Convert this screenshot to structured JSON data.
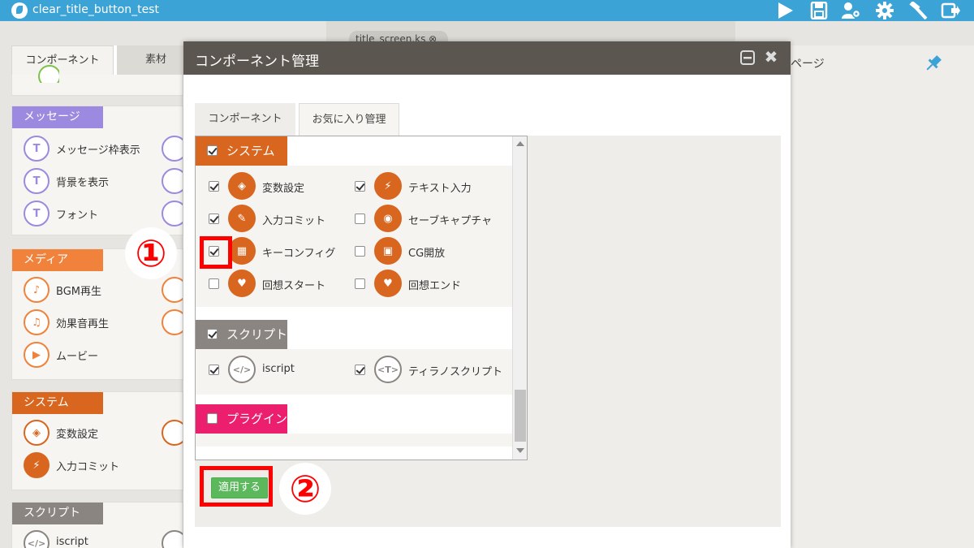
{
  "app": {
    "title": "clear_title_button_test",
    "toolbar_buttons": [
      "play-icon",
      "save-icon",
      "users-gear-icon",
      "gear-icon",
      "hammer-icon",
      "export-icon"
    ]
  },
  "left_panel": {
    "tabs": [
      "コンポーネント",
      "素材"
    ],
    "sections": [
      {
        "label": "メッセージ",
        "color": "#9b8ae0",
        "items": [
          "メッセージ枠表示",
          "背景を表示",
          "フォント"
        ]
      },
      {
        "label": "メディア",
        "color": "#f0823c",
        "items": [
          "BGM再生",
          "効果音再生",
          "ムービー"
        ]
      },
      {
        "label": "システム",
        "color": "#d9661f",
        "items": [
          "変数設定",
          "入力コミット"
        ]
      },
      {
        "label": "スクリプト",
        "color": "#8a8580",
        "items": [
          "iscript"
        ]
      }
    ]
  },
  "editor": {
    "file_tab": "title_screen.ks ⊗"
  },
  "right_panel": {
    "label": "ページ"
  },
  "modal": {
    "title": "コンポーネント管理",
    "tabs": [
      "コンポーネント",
      "お気に入り管理"
    ],
    "groups": [
      {
        "label": "システム",
        "checked": true,
        "color": "#d9661f",
        "items": [
          {
            "label": "変数設定",
            "checked": true,
            "icon": "box-icon"
          },
          {
            "label": "テキスト入力",
            "checked": true,
            "icon": "bolt-icon"
          },
          {
            "label": "入力コミット",
            "checked": true,
            "icon": "plug-icon"
          },
          {
            "label": "セーブキャプチャ",
            "checked": false,
            "icon": "camera-icon"
          },
          {
            "label": "キーコンフィグ",
            "checked": true,
            "icon": "keyboard-icon"
          },
          {
            "label": "CG開放",
            "checked": false,
            "icon": "image-icon"
          },
          {
            "label": "回想スタート",
            "checked": false,
            "icon": "heart-icon"
          },
          {
            "label": "回想エンド",
            "checked": false,
            "icon": "heart-icon"
          }
        ]
      },
      {
        "label": "スクリプト",
        "checked": true,
        "color": "#8a8580",
        "items": [
          {
            "label": "iscript",
            "checked": true,
            "icon": "code-icon"
          },
          {
            "label": "ティラノスクリプト",
            "checked": true,
            "icon": "tag-icon"
          }
        ]
      },
      {
        "label": "プラグイン",
        "checked": false,
        "color": "#ec1f6f",
        "items": []
      }
    ],
    "apply_label": "適用する"
  },
  "annotations": {
    "marker1": "①",
    "marker2": "②",
    "highlight_color": "#ff0000"
  }
}
